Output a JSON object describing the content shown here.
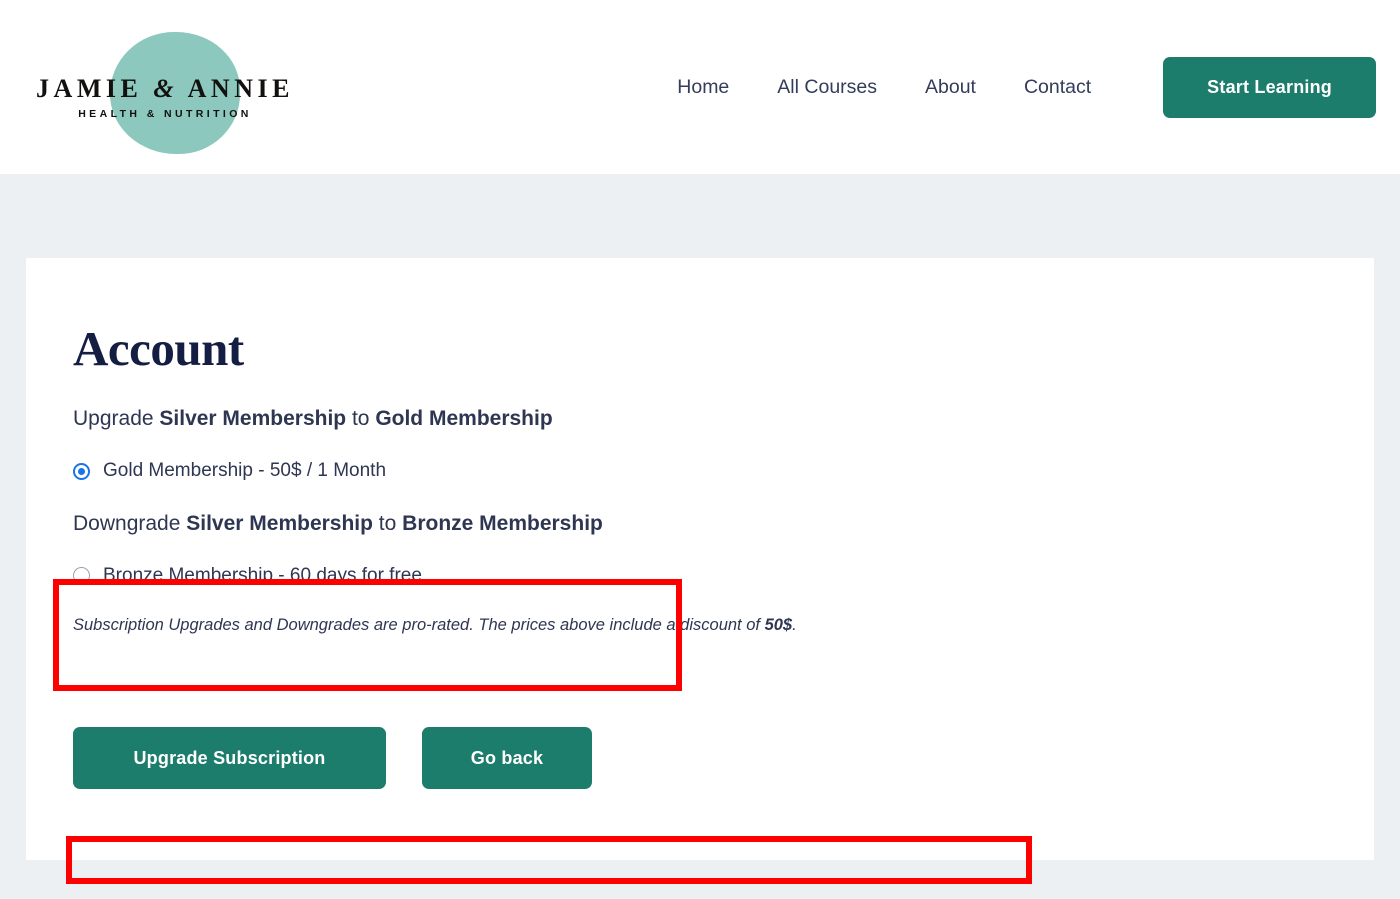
{
  "header": {
    "logo": {
      "name": "JAMIE",
      "amp": "&",
      "name2": "ANNIE",
      "tagline": "HEALTH & NUTRITION",
      "circle_color": "#8cc8bd"
    },
    "nav": [
      {
        "label": "Home"
      },
      {
        "label": "All Courses"
      },
      {
        "label": "About"
      },
      {
        "label": "Contact"
      }
    ],
    "cta_label": "Start Learning",
    "cta_color": "#1d7d6c",
    "nav_text_color": "#333c5a"
  },
  "account": {
    "title": "Account",
    "upgrade": {
      "prefix": "Upgrade ",
      "from_plan": "Silver Membership",
      "middle": " to ",
      "to_plan": "Gold Membership",
      "option_label": "Gold Membership - 50$ / 1 Month",
      "selected": true
    },
    "downgrade": {
      "prefix": "Downgrade ",
      "from_plan": "Silver Membership",
      "middle": " to ",
      "to_plan": "Bronze Membership",
      "option_label": "Bronze Membership - 60 days for free",
      "selected": false
    },
    "disclaimer": {
      "text": "Subscription Upgrades and Downgrades are pro-rated. The prices above include a discount of ",
      "amount": "50$",
      "suffix": "."
    },
    "buttons": {
      "primary_label": "Upgrade Subscription",
      "secondary_label": "Go back"
    }
  },
  "annotations": {
    "color": "#fe0000",
    "boxes": [
      {
        "name": "upgrade-section-highlight"
      },
      {
        "name": "disclaimer-highlight"
      }
    ]
  },
  "theme": {
    "page_background": "#ecf0f3",
    "card_background": "#ffffff",
    "heading_color": "#141e42",
    "body_text_color": "#2e3652",
    "radio_selected_color": "#1b73e8"
  }
}
